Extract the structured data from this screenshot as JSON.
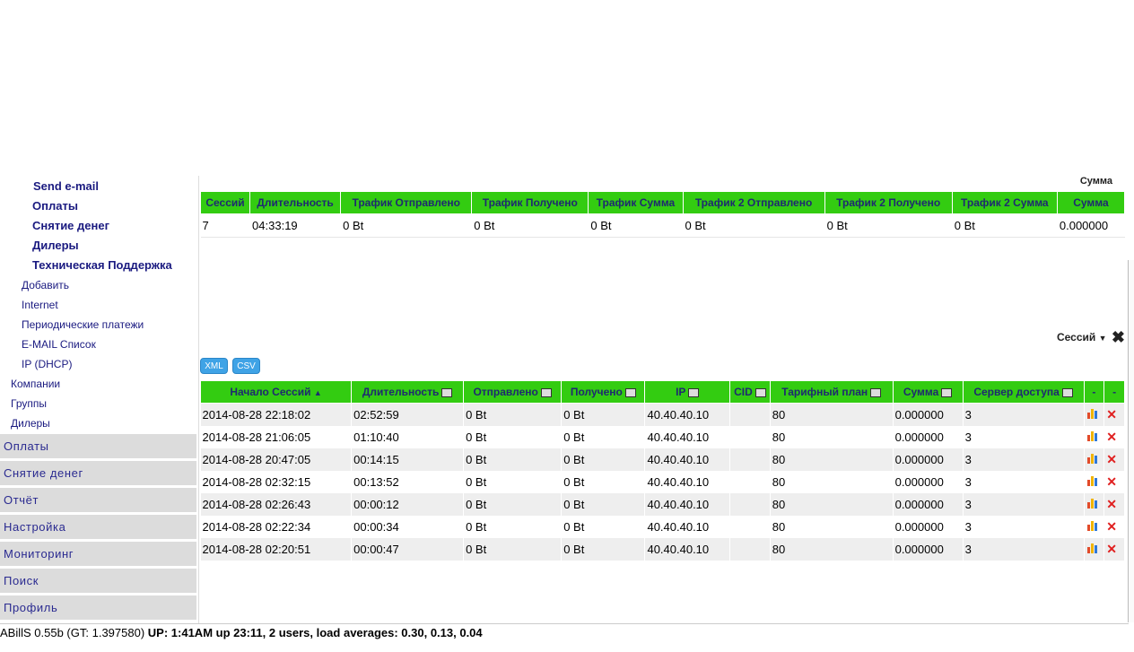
{
  "sidebar": {
    "sub_bold": [
      "Send e-mail",
      "Оплаты",
      "Снятие денег",
      "Дилеры",
      "Техническая Поддержка"
    ],
    "sub_items": [
      "Добавить",
      "Internet",
      "Периодические платежи",
      "E-MAIL Список",
      "IP (DHCP)"
    ],
    "sub_top": [
      "Компании",
      "Группы",
      "Дилеры"
    ],
    "main_menu": [
      "Оплаты",
      "Снятие денег",
      "Отчёт",
      "Настройка",
      "Мониторинг",
      "Поиск",
      "Профиль"
    ]
  },
  "summary": {
    "sum_label": "Сумма",
    "headers": [
      "Сессий",
      "Длительность",
      "Трафик Отправлено",
      "Трафик Получено",
      "Трафик Сумма",
      "Трафик 2 Отправлено",
      "Трафик 2 Получено",
      "Трафик 2 Сумма",
      "Сумма"
    ],
    "values": [
      "7",
      "04:33:19",
      "0 Bt",
      "0 Bt",
      "0 Bt",
      "0 Bt",
      "0 Bt",
      "0 Bt",
      "0.000000"
    ]
  },
  "sessions": {
    "title": "Сессий",
    "export_buttons": [
      "XML",
      "CSV"
    ],
    "headers": [
      "Начало Сессий",
      "Длительность",
      "Отправлено",
      "Получено",
      "IP",
      "CID",
      "Тарифный план",
      "Сумма",
      "Сервер доступа",
      "-",
      "-"
    ],
    "rows": [
      [
        "2014-08-28 22:18:02",
        "02:52:59",
        "0 Bt",
        "0 Bt",
        "40.40.40.10",
        "",
        "80",
        "0.000000",
        "3"
      ],
      [
        "2014-08-28 21:06:05",
        "01:10:40",
        "0 Bt",
        "0 Bt",
        "40.40.40.10",
        "",
        "80",
        "0.000000",
        "3"
      ],
      [
        "2014-08-28 20:47:05",
        "00:14:15",
        "0 Bt",
        "0 Bt",
        "40.40.40.10",
        "",
        "80",
        "0.000000",
        "3"
      ],
      [
        "2014-08-28 02:32:15",
        "00:13:52",
        "0 Bt",
        "0 Bt",
        "40.40.40.10",
        "",
        "80",
        "0.000000",
        "3"
      ],
      [
        "2014-08-28 02:26:43",
        "00:00:12",
        "0 Bt",
        "0 Bt",
        "40.40.40.10",
        "",
        "80",
        "0.000000",
        "3"
      ],
      [
        "2014-08-28 02:22:34",
        "00:00:34",
        "0 Bt",
        "0 Bt",
        "40.40.40.10",
        "",
        "80",
        "0.000000",
        "3"
      ]
    ],
    "last_row": [
      "2014-08-28 02:20:51",
      "00:00:47",
      "0 Bt",
      "0 Bt",
      "40.40.40.10",
      "",
      "80",
      "0.000000",
      "3"
    ]
  },
  "statusbar": {
    "version": "ABillS 0.55b (GT: 1.397580)",
    "uptime": "UP: 1:41AM up 23:11, 2 users, load averages: 0.30, 0.13, 0.04"
  },
  "colors": {
    "header_green": "#33cc11",
    "link_blue": "#1a1a80"
  }
}
